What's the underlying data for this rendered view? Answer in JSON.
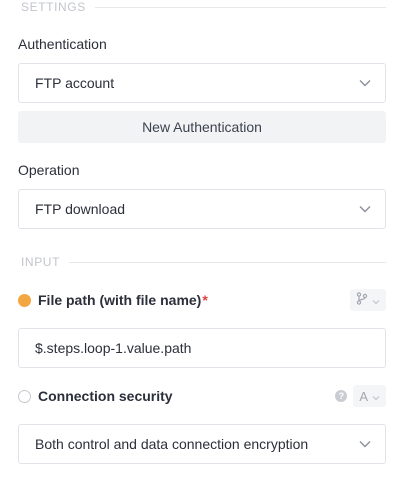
{
  "settings": {
    "section_title": "SETTINGS",
    "authentication": {
      "label": "Authentication",
      "selected": "FTP account",
      "new_button": "New Authentication"
    },
    "operation": {
      "label": "Operation",
      "selected": "FTP download"
    }
  },
  "input": {
    "section_title": "INPUT",
    "file_path": {
      "label": "File path (with file name)",
      "required_mark": "*",
      "value": "$.steps.loop-1.value.path",
      "status_color": "#f4a640",
      "mode_icon": "branch-icon"
    },
    "connection_security": {
      "label": "Connection security",
      "mode_letter": "A",
      "help_glyph": "?",
      "selected": "Both control and data connection encryption"
    }
  }
}
